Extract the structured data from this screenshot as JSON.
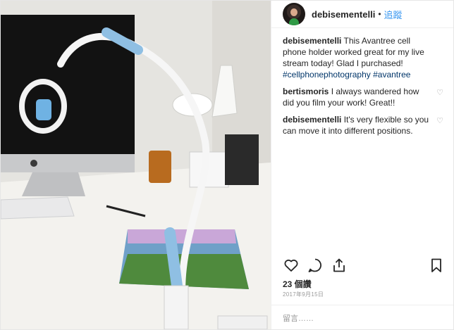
{
  "photo": {
    "alt_subject": "cell phone holder on desk"
  },
  "header": {
    "username": "debisementelli",
    "separator": "•",
    "follow_label": "追蹤"
  },
  "comments": [
    {
      "user": "debisementelli",
      "text": "This Avantree cell phone holder worked great for my live stream today! Glad I purchased!",
      "tags": "#cellphonephotography #avantree",
      "liked": false
    },
    {
      "user": "bertismoris",
      "text": "I always wandered how did you film your work! Great!!",
      "liked": true
    },
    {
      "user": "debisementelli",
      "text": "It's very flexible so you can move it into different positions.",
      "liked": true
    }
  ],
  "actions": {
    "like_icon": "heart-icon",
    "comment_icon": "comment-icon",
    "share_icon": "share-icon",
    "save_icon": "bookmark-icon"
  },
  "likes_text": "23 個讚",
  "date_text": "2017年9月15日",
  "add_comment_placeholder": "留言……"
}
